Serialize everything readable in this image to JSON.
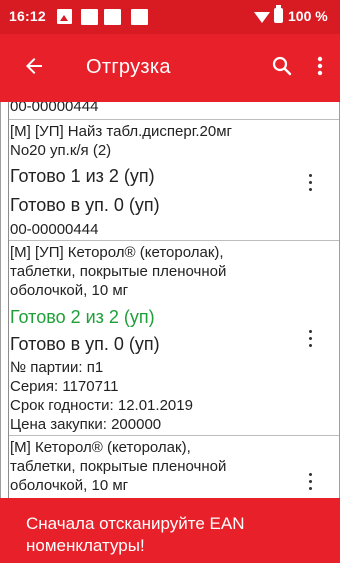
{
  "status_bar": {
    "time": "16:12",
    "battery": "100 %",
    "icons": [
      "image-icon",
      "notification-icon",
      "notification-icon",
      "notification-icon",
      "wifi-icon",
      "battery-icon"
    ]
  },
  "app_bar": {
    "title": "Отгрузка",
    "back_icon": "arrow-back-icon",
    "search_icon": "search-icon",
    "menu_icon": "more-vert-icon"
  },
  "list": {
    "top_code": "00-00000444",
    "items": [
      {
        "name_line1": "[М] [УП] Найз табл.дисперг.20мг",
        "name_line2": "No20 уп.к/я (2)",
        "ready": "Готово 1 из 2 (уп)",
        "ready_in_pack": "Готово в уп. 0 (уп)",
        "code": "00-00000444"
      },
      {
        "name_line1": "[М] [УП] Кеторол® (кеторолак),",
        "name_line2": "таблетки, покрытые пленочной",
        "name_line3": "оболочкой, 10 мг",
        "ready": "Готово 2 из 2 (уп)",
        "ready_in_pack": "Готово в уп. 0 (уп)",
        "batch": "№ партии: п1",
        "series": "Серия: 1170711",
        "expiry": "Срок годности: 12.01.2019",
        "price": "Цена закупки: 200000"
      },
      {
        "name_line1": "[М] Кеторол® (кеторолак),",
        "name_line2": "таблетки, покрытые пленочной",
        "name_line3": "оболочкой, 10 мг"
      }
    ]
  },
  "snackbar": {
    "message": "Сначала отсканируйте EAN номенклатуры!"
  },
  "colors": {
    "primary": "#e8202a",
    "status_bar": "#d81b23",
    "ready_complete": "#1ea038"
  }
}
